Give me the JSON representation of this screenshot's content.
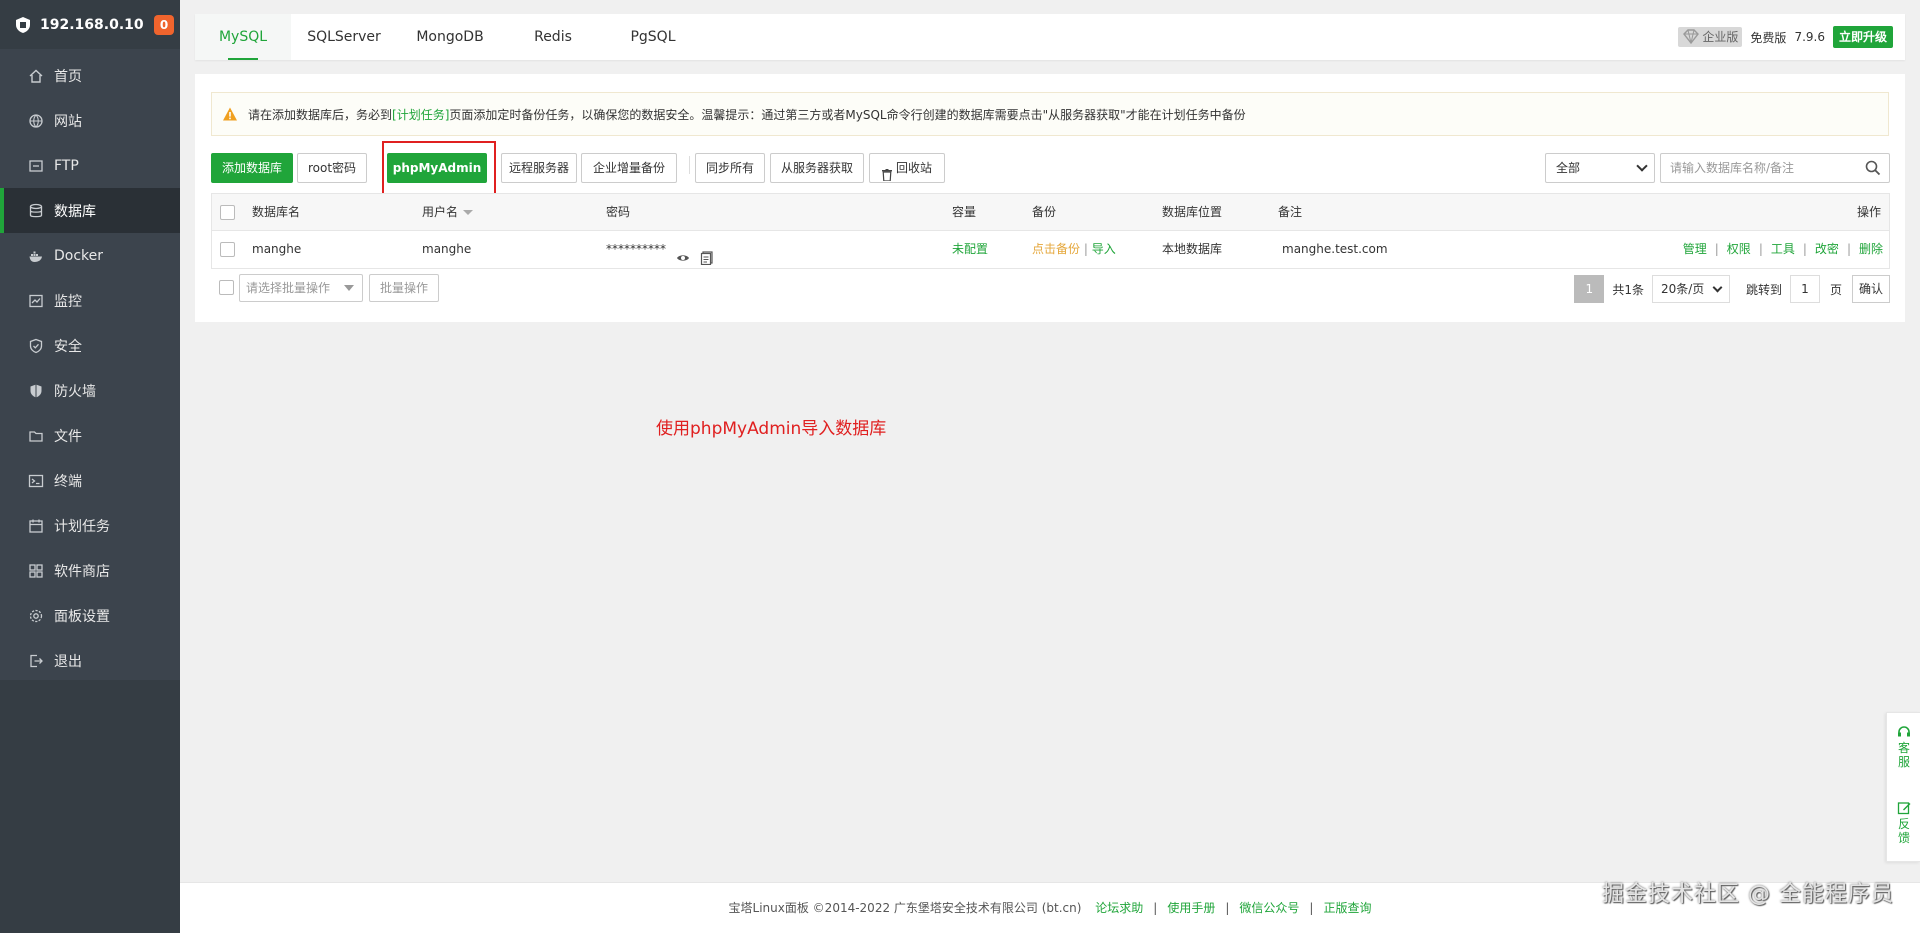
{
  "sidebar": {
    "host": "192.168.0.10",
    "badge": "0",
    "items": [
      {
        "label": "首页",
        "icon": "home-icon"
      },
      {
        "label": "网站",
        "icon": "globe-icon"
      },
      {
        "label": "FTP",
        "icon": "ftp-icon"
      },
      {
        "label": "数据库",
        "icon": "database-icon",
        "active": true
      },
      {
        "label": "Docker",
        "icon": "docker-icon"
      },
      {
        "label": "监控",
        "icon": "monitor-icon"
      },
      {
        "label": "安全",
        "icon": "shield-icon"
      },
      {
        "label": "防火墙",
        "icon": "firewall-icon"
      },
      {
        "label": "文件",
        "icon": "folder-icon"
      },
      {
        "label": "终端",
        "icon": "terminal-icon"
      },
      {
        "label": "计划任务",
        "icon": "calendar-icon"
      },
      {
        "label": "软件商店",
        "icon": "apps-icon"
      },
      {
        "label": "面板设置",
        "icon": "gear-icon"
      },
      {
        "label": "退出",
        "icon": "logout-icon"
      }
    ]
  },
  "tabs": [
    {
      "label": "MySQL",
      "active": true
    },
    {
      "label": "SQLServer"
    },
    {
      "label": "MongoDB"
    },
    {
      "label": "Redis"
    },
    {
      "label": "PgSQL"
    }
  ],
  "topbar": {
    "enterprise": "企业版",
    "edition": "免费版",
    "version": "7.9.6",
    "upgrade": "立即升级"
  },
  "alert": {
    "text_before": "请在添加数据库后，务必到",
    "link": "[计划任务]",
    "text_after": "页面添加定时备份任务，以确保您的数据安全。温馨提示：通过第三方或者MySQL命令行创建的数据库需要点击\"从服务器获取\"才能在计划任务中备份"
  },
  "toolbar": {
    "add_db": "添加数据库",
    "root_pwd": "root密码",
    "phpmyadmin": "phpMyAdmin",
    "remote": "远程服务器",
    "incremental": "企业增量备份",
    "sync_all": "同步所有",
    "fetch": "从服务器获取",
    "recycle": "回收站",
    "filter_value": "全部",
    "search_placeholder": "请输入数据库名称/备注"
  },
  "table": {
    "headers": {
      "name": "数据库名",
      "user": "用户名",
      "password": "密码",
      "capacity": "容量",
      "backup": "备份",
      "location": "数据库位置",
      "remark": "备注",
      "ops": "操作"
    },
    "rows": [
      {
        "name": "manghe",
        "user": "manghe",
        "password": "**********",
        "capacity": "未配置",
        "backup_click": "点击备份",
        "backup_sep": "|",
        "backup_import": "导入",
        "location": "本地数据库",
        "remark": "manghe.test.com",
        "ops": [
          "管理",
          "权限",
          "工具",
          "改密",
          "删除"
        ]
      }
    ]
  },
  "bulk": {
    "select_placeholder": "请选择批量操作",
    "button": "批量操作"
  },
  "pager": {
    "current": "1",
    "total": "共1条",
    "page_size": "20条/页",
    "jump_label": "跳转到",
    "jump_value": "1",
    "unit": "页",
    "confirm": "确认"
  },
  "note": "使用phpMyAdmin导入数据库",
  "float": {
    "service": "客服",
    "feedback": "反馈"
  },
  "footer": {
    "copyright": "宝塔Linux面板 ©2014-2022 广东堡塔安全技术有限公司 (bt.cn)",
    "links": [
      "论坛求助",
      "使用手册",
      "微信公众号",
      "正版查询"
    ],
    "sep": "|"
  },
  "watermark": "掘金技术社区 @ 全能程序员"
}
